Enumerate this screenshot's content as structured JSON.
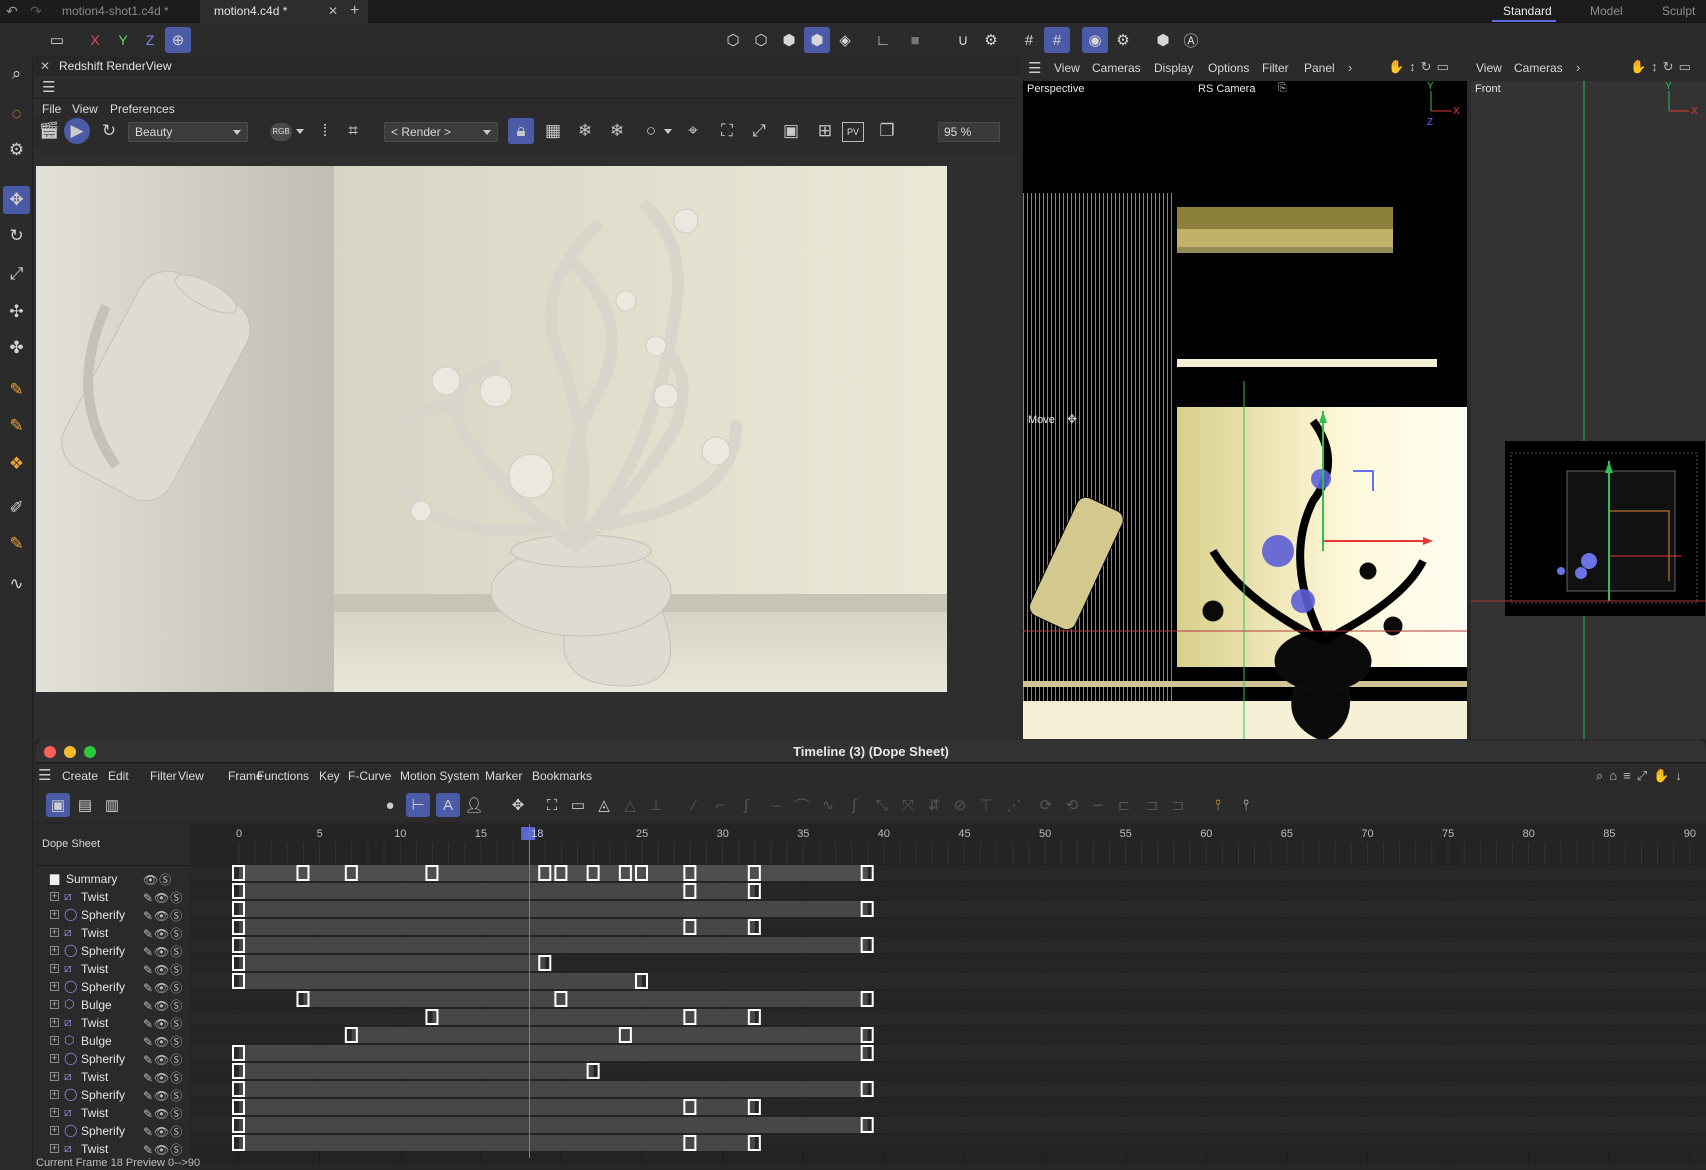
{
  "file_tabs": [
    {
      "label": "motion4-shot1.c4d *",
      "active": false
    },
    {
      "label": "motion4.c4d *",
      "active": true
    }
  ],
  "layouts": [
    {
      "label": "Standard",
      "active": true
    },
    {
      "label": "Model",
      "active": false
    },
    {
      "label": "Sculpt",
      "active": false
    }
  ],
  "render_view": {
    "title": "Redshift RenderView",
    "menu": [
      "File",
      "View",
      "Preferences"
    ],
    "aov_select": "Beauty",
    "rgb_label": "RGB",
    "render_select": "< Render >",
    "zoom": "95 %",
    "pv_label": "PV"
  },
  "viewport_menu": [
    "View",
    "Cameras",
    "Display",
    "Options",
    "Filter",
    "Panel"
  ],
  "viewport_menu_right": [
    "View",
    "Cameras"
  ],
  "perspective": {
    "label": "Perspective",
    "camera": "RS Camera",
    "tool": "Move",
    "axes": {
      "y": "Y",
      "x": "X",
      "z": "Z"
    }
  },
  "front": {
    "label": "Front",
    "axes": {
      "y": "Y",
      "x": "X"
    }
  },
  "timeline": {
    "title": "Timeline (3) (Dope Sheet)",
    "menu": [
      "Create",
      "Edit",
      "Filter",
      "View",
      "Frame",
      "Functions",
      "Key",
      "F-Curve",
      "Motion System",
      "Marker",
      "Bookmarks"
    ],
    "panel_label": "Dope Sheet",
    "ruler_ticks": [
      "0",
      "5",
      "10",
      "15",
      "",
      "25",
      "30",
      "35",
      "40",
      "45",
      "50",
      "55",
      "60",
      "65",
      "70",
      "75",
      "80",
      "85",
      "90"
    ],
    "current_frame_marker": "18",
    "current_frame": 18,
    "frame_range": [
      0,
      90
    ],
    "summary_label": "Summary",
    "tracks": [
      {
        "name": "Twist",
        "icon": "twist",
        "keys": [
          0,
          28,
          32
        ],
        "bar": [
          0,
          32
        ]
      },
      {
        "name": "Spherify",
        "icon": "spherify",
        "keys": [
          0,
          39
        ],
        "bar": [
          0,
          39
        ]
      },
      {
        "name": "Twist",
        "icon": "twist",
        "keys": [
          0,
          28,
          32
        ],
        "bar": [
          0,
          32
        ]
      },
      {
        "name": "Spherify",
        "icon": "spherify",
        "keys": [
          0,
          39
        ],
        "bar": [
          0,
          39
        ]
      },
      {
        "name": "Twist",
        "icon": "twist",
        "keys": [
          0,
          19
        ],
        "bar": [
          0,
          19
        ]
      },
      {
        "name": "Spherify",
        "icon": "spherify",
        "keys": [
          0,
          25
        ],
        "bar": [
          0,
          25
        ]
      },
      {
        "name": "Bulge",
        "icon": "bulge",
        "keys": [
          4,
          20,
          39
        ],
        "bar": [
          4,
          39
        ]
      },
      {
        "name": "Twist",
        "icon": "twist",
        "keys": [
          12,
          28,
          32
        ],
        "bar": [
          12,
          32
        ]
      },
      {
        "name": "Bulge",
        "icon": "bulge",
        "keys": [
          7,
          24,
          39
        ],
        "bar": [
          7,
          39
        ]
      },
      {
        "name": "Spherify",
        "icon": "spherify",
        "keys": [
          0,
          39
        ],
        "bar": [
          0,
          39
        ]
      },
      {
        "name": "Twist",
        "icon": "twist",
        "keys": [
          0,
          22
        ],
        "bar": [
          0,
          22
        ]
      },
      {
        "name": "Spherify",
        "icon": "spherify",
        "keys": [
          0,
          39
        ],
        "bar": [
          0,
          39
        ]
      },
      {
        "name": "Twist",
        "icon": "twist",
        "keys": [
          0,
          28,
          32
        ],
        "bar": [
          0,
          32
        ]
      },
      {
        "name": "Spherify",
        "icon": "spherify",
        "keys": [
          0,
          39
        ],
        "bar": [
          0,
          39
        ]
      },
      {
        "name": "Twist",
        "icon": "twist",
        "keys": [
          0,
          28,
          32
        ],
        "bar": [
          0,
          32
        ]
      }
    ],
    "summary_keys": [
      0,
      4,
      7,
      12,
      19,
      20,
      22,
      24,
      25,
      28,
      32,
      39
    ]
  },
  "status": {
    "text": "Current Frame  18   Preview  0-->90"
  },
  "colors": {
    "accent": "#4b5ba8",
    "key": "#ffffff",
    "axis_x": "#e53935",
    "axis_y": "#33cc66",
    "axis_z": "#5c6bff"
  }
}
